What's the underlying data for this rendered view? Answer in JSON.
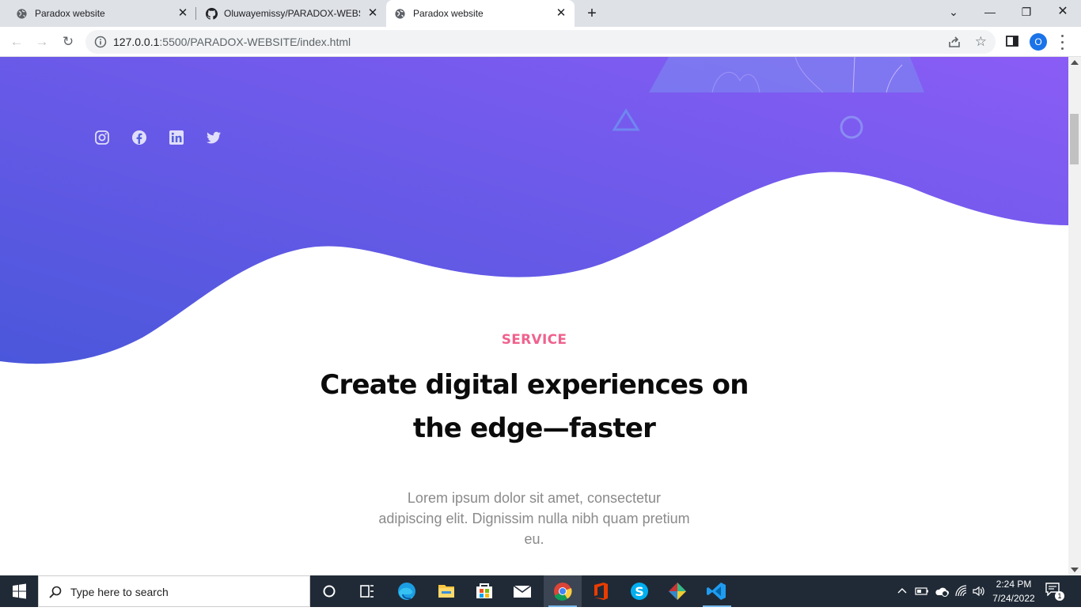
{
  "browser": {
    "tabs": [
      {
        "title": "Paradox website",
        "icon": "globe-icon",
        "active": false
      },
      {
        "title": "Oluwayemissy/PARADOX-WEBSITE",
        "icon": "github-icon",
        "active": false
      },
      {
        "title": "Paradox website",
        "icon": "globe-icon",
        "active": true
      }
    ],
    "url_host": "127.0.0.1",
    "url_rest": ":5500/PARADOX-WEBSITE/index.html",
    "profile_initial": "O"
  },
  "hero": {
    "gradient_start": "#4a57db",
    "gradient_end": "#8a5cf6",
    "social_icons": [
      "instagram-icon",
      "facebook-icon",
      "linkedin-icon",
      "twitter-icon"
    ]
  },
  "service": {
    "label": "SERVICE",
    "headline": "Create digital experiences on the edge—faster",
    "description": "Lorem ipsum dolor sit amet, consectetur adipiscing elit. Dignissim nulla nibh quam pretium eu.",
    "label_color": "#f0628e"
  },
  "taskbar": {
    "search_placeholder": "Type here to search",
    "time": "2:24 PM",
    "date": "7/24/2022",
    "notification_count": "1",
    "apps": [
      "cortana-icon",
      "task-view-icon",
      "edge-icon",
      "file-explorer-icon",
      "store-icon",
      "mail-icon",
      "chrome-icon",
      "office-icon",
      "skype-icon",
      "git-icon",
      "vscode-icon"
    ]
  }
}
